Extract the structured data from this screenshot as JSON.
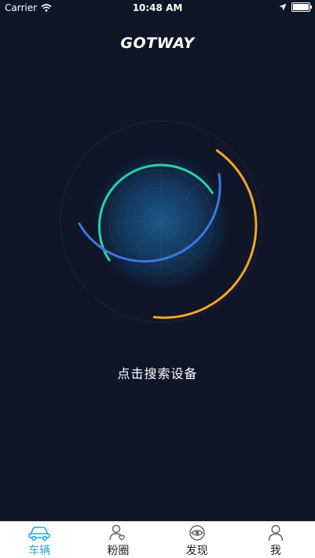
{
  "status_bar": {
    "carrier": "Carrier",
    "time": "10:48 AM",
    "battery_level": 0.95
  },
  "header": {
    "logo_text": "GOTWAY"
  },
  "main": {
    "prompt": "点击搜索设备"
  },
  "tabs": [
    {
      "label": "车辆",
      "icon": "car-icon",
      "active": true
    },
    {
      "label": "粉圈",
      "icon": "fans-icon",
      "active": false
    },
    {
      "label": "发现",
      "icon": "eye-icon",
      "active": false
    },
    {
      "label": "我",
      "icon": "user-icon",
      "active": false
    }
  ],
  "colors": {
    "background": "#0f1628",
    "accent_active": "#2aa6d8",
    "ring_teal": "#2bd1a6",
    "ring_blue": "#3a78e0",
    "ring_orange": "#f5a623"
  }
}
